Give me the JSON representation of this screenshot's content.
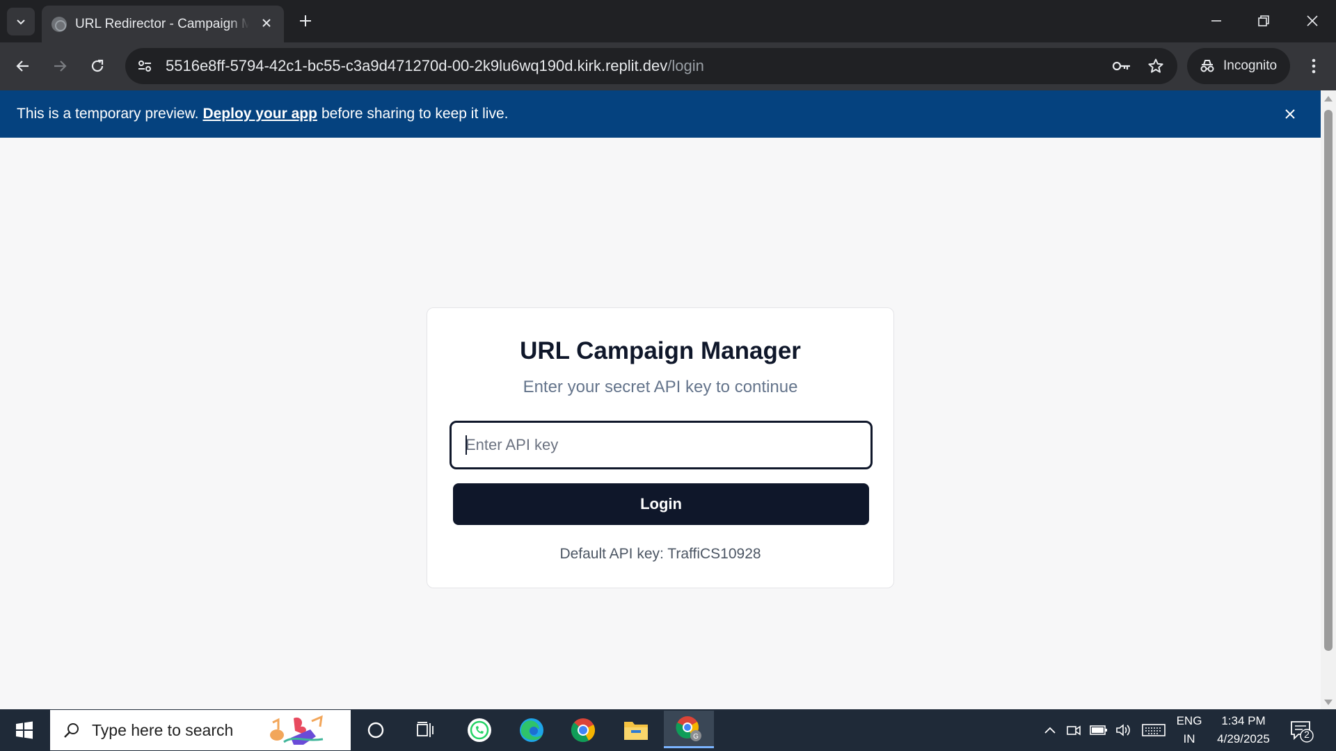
{
  "browser": {
    "tab": {
      "title": "URL Redirector - Campaign Manager"
    },
    "address": {
      "host": "5516e8ff-5794-42c1-bc55-c3a9d471270d-00-2k9lu6wq190d.kirk.replit.dev",
      "path": "/login"
    },
    "profile_label": "Incognito"
  },
  "banner": {
    "text_before": "This is a temporary preview.",
    "link": "Deploy your app",
    "text_after": "before sharing to keep it live.",
    "color": "#05427f"
  },
  "login": {
    "title": "URL Campaign Manager",
    "subtitle": "Enter your secret API key to continue",
    "input_placeholder": "Enter API key",
    "input_value": "",
    "button_label": "Login",
    "hint": "Default API key: TraffiCS10928",
    "accent": "#0f172a"
  },
  "taskbar": {
    "search_placeholder": "Type here to search",
    "apps": [
      "cortana-icon",
      "task-view-icon",
      "whatsapp-icon",
      "edge-icon",
      "chrome-icon",
      "file-explorer-icon",
      "chrome-profile-icon"
    ],
    "language": {
      "line1": "ENG",
      "line2": "IN"
    },
    "time": "1:34 PM",
    "date": "4/29/2025",
    "notification_count": "2"
  }
}
